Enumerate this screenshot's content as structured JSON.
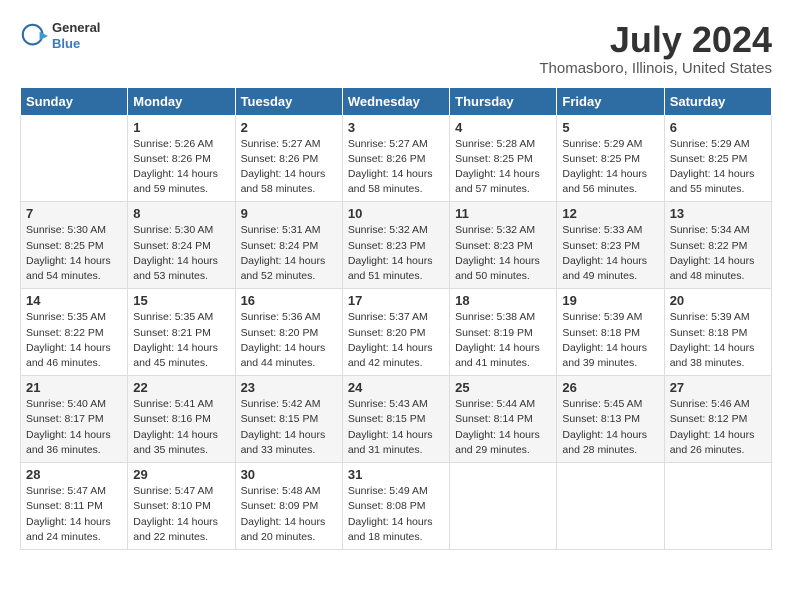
{
  "header": {
    "logo_line1": "General",
    "logo_line2": "Blue",
    "title": "July 2024",
    "subtitle": "Thomasboro, Illinois, United States"
  },
  "weekdays": [
    "Sunday",
    "Monday",
    "Tuesday",
    "Wednesday",
    "Thursday",
    "Friday",
    "Saturday"
  ],
  "weeks": [
    [
      {
        "day": "",
        "info": ""
      },
      {
        "day": "1",
        "info": "Sunrise: 5:26 AM\nSunset: 8:26 PM\nDaylight: 14 hours\nand 59 minutes."
      },
      {
        "day": "2",
        "info": "Sunrise: 5:27 AM\nSunset: 8:26 PM\nDaylight: 14 hours\nand 58 minutes."
      },
      {
        "day": "3",
        "info": "Sunrise: 5:27 AM\nSunset: 8:26 PM\nDaylight: 14 hours\nand 58 minutes."
      },
      {
        "day": "4",
        "info": "Sunrise: 5:28 AM\nSunset: 8:25 PM\nDaylight: 14 hours\nand 57 minutes."
      },
      {
        "day": "5",
        "info": "Sunrise: 5:29 AM\nSunset: 8:25 PM\nDaylight: 14 hours\nand 56 minutes."
      },
      {
        "day": "6",
        "info": "Sunrise: 5:29 AM\nSunset: 8:25 PM\nDaylight: 14 hours\nand 55 minutes."
      }
    ],
    [
      {
        "day": "7",
        "info": "Sunrise: 5:30 AM\nSunset: 8:25 PM\nDaylight: 14 hours\nand 54 minutes."
      },
      {
        "day": "8",
        "info": "Sunrise: 5:30 AM\nSunset: 8:24 PM\nDaylight: 14 hours\nand 53 minutes."
      },
      {
        "day": "9",
        "info": "Sunrise: 5:31 AM\nSunset: 8:24 PM\nDaylight: 14 hours\nand 52 minutes."
      },
      {
        "day": "10",
        "info": "Sunrise: 5:32 AM\nSunset: 8:23 PM\nDaylight: 14 hours\nand 51 minutes."
      },
      {
        "day": "11",
        "info": "Sunrise: 5:32 AM\nSunset: 8:23 PM\nDaylight: 14 hours\nand 50 minutes."
      },
      {
        "day": "12",
        "info": "Sunrise: 5:33 AM\nSunset: 8:23 PM\nDaylight: 14 hours\nand 49 minutes."
      },
      {
        "day": "13",
        "info": "Sunrise: 5:34 AM\nSunset: 8:22 PM\nDaylight: 14 hours\nand 48 minutes."
      }
    ],
    [
      {
        "day": "14",
        "info": "Sunrise: 5:35 AM\nSunset: 8:22 PM\nDaylight: 14 hours\nand 46 minutes."
      },
      {
        "day": "15",
        "info": "Sunrise: 5:35 AM\nSunset: 8:21 PM\nDaylight: 14 hours\nand 45 minutes."
      },
      {
        "day": "16",
        "info": "Sunrise: 5:36 AM\nSunset: 8:20 PM\nDaylight: 14 hours\nand 44 minutes."
      },
      {
        "day": "17",
        "info": "Sunrise: 5:37 AM\nSunset: 8:20 PM\nDaylight: 14 hours\nand 42 minutes."
      },
      {
        "day": "18",
        "info": "Sunrise: 5:38 AM\nSunset: 8:19 PM\nDaylight: 14 hours\nand 41 minutes."
      },
      {
        "day": "19",
        "info": "Sunrise: 5:39 AM\nSunset: 8:18 PM\nDaylight: 14 hours\nand 39 minutes."
      },
      {
        "day": "20",
        "info": "Sunrise: 5:39 AM\nSunset: 8:18 PM\nDaylight: 14 hours\nand 38 minutes."
      }
    ],
    [
      {
        "day": "21",
        "info": "Sunrise: 5:40 AM\nSunset: 8:17 PM\nDaylight: 14 hours\nand 36 minutes."
      },
      {
        "day": "22",
        "info": "Sunrise: 5:41 AM\nSunset: 8:16 PM\nDaylight: 14 hours\nand 35 minutes."
      },
      {
        "day": "23",
        "info": "Sunrise: 5:42 AM\nSunset: 8:15 PM\nDaylight: 14 hours\nand 33 minutes."
      },
      {
        "day": "24",
        "info": "Sunrise: 5:43 AM\nSunset: 8:15 PM\nDaylight: 14 hours\nand 31 minutes."
      },
      {
        "day": "25",
        "info": "Sunrise: 5:44 AM\nSunset: 8:14 PM\nDaylight: 14 hours\nand 29 minutes."
      },
      {
        "day": "26",
        "info": "Sunrise: 5:45 AM\nSunset: 8:13 PM\nDaylight: 14 hours\nand 28 minutes."
      },
      {
        "day": "27",
        "info": "Sunrise: 5:46 AM\nSunset: 8:12 PM\nDaylight: 14 hours\nand 26 minutes."
      }
    ],
    [
      {
        "day": "28",
        "info": "Sunrise: 5:47 AM\nSunset: 8:11 PM\nDaylight: 14 hours\nand 24 minutes."
      },
      {
        "day": "29",
        "info": "Sunrise: 5:47 AM\nSunset: 8:10 PM\nDaylight: 14 hours\nand 22 minutes."
      },
      {
        "day": "30",
        "info": "Sunrise: 5:48 AM\nSunset: 8:09 PM\nDaylight: 14 hours\nand 20 minutes."
      },
      {
        "day": "31",
        "info": "Sunrise: 5:49 AM\nSunset: 8:08 PM\nDaylight: 14 hours\nand 18 minutes."
      },
      {
        "day": "",
        "info": ""
      },
      {
        "day": "",
        "info": ""
      },
      {
        "day": "",
        "info": ""
      }
    ]
  ]
}
